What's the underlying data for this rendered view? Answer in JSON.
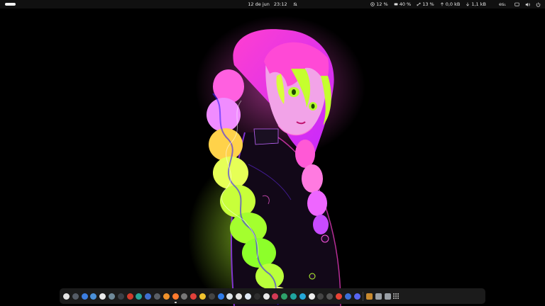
{
  "topbar": {
    "date": "12 de jun",
    "time": "23:12",
    "stats": [
      {
        "icon": "cpu-icon",
        "value": "12 %"
      },
      {
        "icon": "memory-icon",
        "value": "40 %"
      },
      {
        "icon": "swap-icon",
        "value": "13 %"
      },
      {
        "icon": "upload-icon",
        "value": "0,0 kB"
      },
      {
        "icon": "download-icon",
        "value": "1,1 kB"
      }
    ],
    "keyboard_layout": "es₁"
  },
  "dock": {
    "apps": [
      {
        "name": "help-app",
        "color": "#e6e6e6"
      },
      {
        "name": "camera-app",
        "color": "#555c66"
      },
      {
        "name": "mail-app",
        "color": "#3b7de0"
      },
      {
        "name": "browser-blue-app",
        "color": "#4a90d9"
      },
      {
        "name": "chrome-app",
        "color": "#e9e9e9"
      },
      {
        "name": "monitor-app",
        "color": "#6f8a9a"
      },
      {
        "name": "terminal-app",
        "color": "#3a3f46"
      },
      {
        "name": "red-app",
        "color": "#d23b2b"
      },
      {
        "name": "teal-app",
        "color": "#27a69a"
      },
      {
        "name": "globe-app",
        "color": "#3f6fd1"
      },
      {
        "name": "settings-app",
        "color": "#5a5f66"
      },
      {
        "name": "orange-app",
        "color": "#f0922b"
      },
      {
        "name": "firefox-app",
        "color": "#ff7b2e",
        "active": true
      },
      {
        "name": "opera-app",
        "color": "#777"
      },
      {
        "name": "vivaldi-app",
        "color": "#e0413a"
      },
      {
        "name": "yellow-app",
        "color": "#f0c22e"
      },
      {
        "name": "edit-app",
        "color": "#444"
      },
      {
        "name": "check-app",
        "color": "#2f7be8"
      },
      {
        "name": "sheet-app",
        "color": "#dde3e8"
      },
      {
        "name": "docs-app",
        "color": "#e5e5e5"
      },
      {
        "name": "info-app",
        "color": "#dfe9f5"
      },
      {
        "name": "music-app",
        "color": "#2e2e2e"
      },
      {
        "name": "cup-app",
        "color": "#e8e8e8"
      },
      {
        "name": "pink-app",
        "color": "#d33b55"
      },
      {
        "name": "photos-app",
        "color": "#2ea36a"
      },
      {
        "name": "code-app",
        "color": "#1fa5a0"
      },
      {
        "name": "diamond-app",
        "color": "#25a7d8"
      },
      {
        "name": "circle-app",
        "color": "#ececec"
      },
      {
        "name": "arrow-app",
        "color": "#444"
      },
      {
        "name": "tools-app",
        "color": "#555"
      },
      {
        "name": "gmail-app",
        "color": "#e84335"
      },
      {
        "name": "discord-app",
        "color": "#3a6fd8"
      },
      {
        "name": "chat-app",
        "color": "#5865f2"
      },
      {
        "name": "files-app",
        "color": "#c7892e"
      },
      {
        "name": "text-app",
        "color": "#9aa0a6"
      },
      {
        "name": "calculator-app",
        "color": "#9aa0a6"
      }
    ]
  }
}
